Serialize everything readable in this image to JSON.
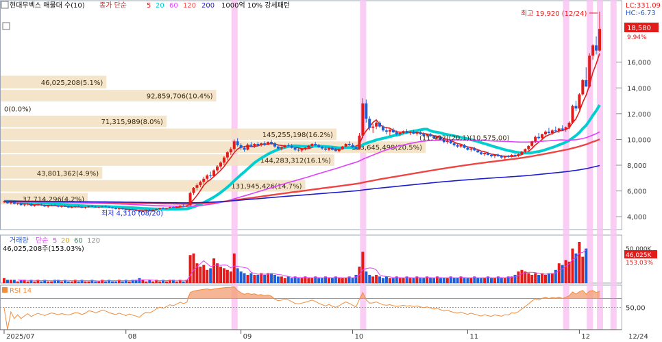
{
  "header": {
    "title": "현대무벡스 매물대 수(10)",
    "ma_label": "종가 단순",
    "ma_periods": [
      "5",
      "20",
      "60",
      "120",
      "200"
    ],
    "ma_colors": [
      "#e31a1c",
      "#00ced1",
      "#e040fb",
      "#ef4444",
      "#1d1dcc"
    ],
    "strong_label": "1000억 10% 강세패턴"
  },
  "right_info": {
    "lc": "LC:331.09",
    "hc": "HC:-6.73"
  },
  "price_badge": {
    "value": "18,580",
    "pct": "9.94%"
  },
  "annotations": {
    "high": "최고 19,920 (12/24)",
    "low": "최저 4,310 (08/20)"
  },
  "volume_panel": {
    "title": "거래량",
    "ma_label": "단순",
    "ma_periods": [
      "5",
      "20",
      "60",
      "120"
    ],
    "ma_colors": [
      "#e040fb",
      "#d4a017",
      "#2e8b57",
      "#888888"
    ],
    "info": "46,025,208주(153.03%)",
    "badge_value": "46,025K",
    "badge_pct": "153.03%",
    "axis_label": "50,000K"
  },
  "rsi_panel": {
    "title": "RSI 14",
    "axis_label": "50,00"
  },
  "date_labels": [
    "2025/07",
    "08",
    "09",
    "10",
    "11",
    "12",
    "12/24"
  ],
  "chart_data": {
    "type": "candlestick",
    "y_ticks": [
      "4,000",
      "6,000",
      "8,000",
      "10,000",
      "12,000",
      "14,000",
      "16,000"
    ],
    "ylim": [
      3000,
      19920
    ],
    "volume_profile": [
      {
        "label": "46,025,208(5.1%)",
        "price_low": 13900,
        "price_high": 15000,
        "width_pct": 5.1
      },
      {
        "label": "92,859,706(10.4%)",
        "price_low": 12900,
        "price_high": 13900,
        "width_pct": 10.4
      },
      {
        "label": "0(0.0%)",
        "price_low": 11900,
        "price_high": 12900,
        "width_pct": 0.0
      },
      {
        "label": "71,315,989(8.0%)",
        "price_low": 10900,
        "price_high": 11900,
        "width_pct": 8.0
      },
      {
        "label": "145,255,198(16.2%)",
        "price_low": 9900,
        "price_high": 10900,
        "width_pct": 16.2
      },
      {
        "label": "183,645,498(20.5%)",
        "price_low": 8900,
        "price_high": 9900,
        "width_pct": 20.5
      },
      {
        "label": "144,283,312(16.1%)",
        "price_low": 7900,
        "price_high": 8900,
        "width_pct": 16.1
      },
      {
        "label": "43,801,362(4.9%)",
        "price_low": 6900,
        "price_high": 7900,
        "width_pct": 4.9
      },
      {
        "label": "131,945,426(14.7%)",
        "price_low": 5900,
        "price_high": 6900,
        "width_pct": 14.7
      },
      {
        "label": "37,714,296(4.2%)",
        "price_low": 4900,
        "price_high": 5900,
        "width_pct": 4.2
      }
    ],
    "price_line_label": "(11,492)(20,1)(10,575,00)",
    "highlight_dates_index": [
      68,
      106,
      166,
      173,
      176,
      180
    ],
    "candles": [
      [
        5150,
        5250,
        5050,
        5200
      ],
      [
        5200,
        5280,
        5000,
        5050
      ],
      [
        5050,
        5200,
        4950,
        5150
      ],
      [
        5150,
        5180,
        4950,
        5000
      ],
      [
        5000,
        5100,
        4900,
        5050
      ],
      [
        5050,
        5100,
        4850,
        4900
      ],
      [
        4900,
        5000,
        4800,
        4950
      ],
      [
        4950,
        5050,
        4880,
        5000
      ],
      [
        5000,
        5050,
        4800,
        4850
      ],
      [
        4850,
        4950,
        4780,
        4900
      ],
      [
        4900,
        5000,
        4820,
        4950
      ],
      [
        4950,
        5020,
        4850,
        4880
      ],
      [
        4880,
        4950,
        4750,
        4800
      ],
      [
        4800,
        4900,
        4700,
        4850
      ],
      [
        4850,
        4950,
        4800,
        4900
      ],
      [
        4900,
        4980,
        4820,
        4850
      ],
      [
        4850,
        4900,
        4720,
        4780
      ],
      [
        4780,
        4880,
        4700,
        4820
      ],
      [
        4820,
        4900,
        4750,
        4770
      ],
      [
        4770,
        4850,
        4680,
        4720
      ],
      [
        4720,
        4800,
        4650,
        4760
      ],
      [
        4760,
        4850,
        4700,
        4800
      ],
      [
        4800,
        4880,
        4750,
        4780
      ],
      [
        4780,
        4820,
        4650,
        4700
      ],
      [
        4700,
        4780,
        4620,
        4740
      ],
      [
        4740,
        4850,
        4700,
        4820
      ],
      [
        4820,
        4900,
        4760,
        4790
      ],
      [
        4790,
        4850,
        4700,
        4720
      ],
      [
        4720,
        4800,
        4660,
        4760
      ],
      [
        4760,
        4840,
        4720,
        4800
      ],
      [
        4800,
        4880,
        4740,
        4770
      ],
      [
        4770,
        4820,
        4680,
        4700
      ],
      [
        4700,
        4760,
        4620,
        4650
      ],
      [
        4650,
        4720,
        4560,
        4600
      ],
      [
        4600,
        4680,
        4520,
        4640
      ],
      [
        4640,
        4700,
        4560,
        4580
      ],
      [
        4580,
        4640,
        4480,
        4520
      ],
      [
        4520,
        4600,
        4450,
        4560
      ],
      [
        4560,
        4620,
        4480,
        4500
      ],
      [
        4500,
        4560,
        4400,
        4450
      ],
      [
        4450,
        4520,
        4310,
        4380
      ],
      [
        4380,
        4500,
        4340,
        4460
      ],
      [
        4460,
        4560,
        4420,
        4520
      ],
      [
        4520,
        4600,
        4450,
        4480
      ],
      [
        4480,
        4550,
        4420,
        4530
      ],
      [
        4530,
        4620,
        4500,
        4600
      ],
      [
        4600,
        4700,
        4550,
        4660
      ],
      [
        4660,
        4750,
        4600,
        4620
      ],
      [
        4620,
        4700,
        4580,
        4680
      ],
      [
        4680,
        4780,
        4640,
        4750
      ],
      [
        4750,
        4850,
        4700,
        4720
      ],
      [
        4720,
        4800,
        4680,
        4780
      ],
      [
        4780,
        4900,
        4740,
        4860
      ],
      [
        4860,
        4950,
        4800,
        4820
      ],
      [
        4820,
        4900,
        4760,
        4880
      ],
      [
        4880,
        5950,
        4860,
        5850
      ],
      [
        5850,
        6300,
        5700,
        6250
      ],
      [
        6250,
        6600,
        6050,
        6450
      ],
      [
        6450,
        6800,
        6300,
        6700
      ],
      [
        6700,
        7100,
        6550,
        6950
      ],
      [
        6950,
        7300,
        6800,
        7200
      ],
      [
        7200,
        7500,
        7000,
        7150
      ],
      [
        7150,
        7700,
        7100,
        7600
      ],
      [
        7600,
        8000,
        7450,
        7900
      ],
      [
        7900,
        8300,
        7700,
        8200
      ],
      [
        8200,
        8700,
        8000,
        8600
      ],
      [
        8600,
        9100,
        8400,
        9000
      ],
      [
        9000,
        9400,
        8800,
        9250
      ],
      [
        9250,
        10000,
        9100,
        9850
      ],
      [
        9850,
        10100,
        9450,
        9550
      ],
      [
        9550,
        9700,
        9200,
        9350
      ],
      [
        9350,
        9500,
        9050,
        9200
      ],
      [
        9200,
        9700,
        9150,
        9600
      ],
      [
        9600,
        9800,
        9400,
        9500
      ],
      [
        9500,
        9700,
        9350,
        9650
      ],
      [
        9650,
        9800,
        9450,
        9550
      ],
      [
        9550,
        9750,
        9450,
        9700
      ],
      [
        9700,
        9850,
        9500,
        9600
      ],
      [
        9600,
        9850,
        9550,
        9800
      ],
      [
        9800,
        9950,
        9600,
        9700
      ],
      [
        9700,
        9800,
        9350,
        9450
      ],
      [
        9450,
        9550,
        9200,
        9300
      ],
      [
        9300,
        9450,
        9150,
        9400
      ],
      [
        9400,
        9600,
        9300,
        9550
      ],
      [
        9550,
        9700,
        9400,
        9500
      ],
      [
        9500,
        9650,
        9300,
        9350
      ],
      [
        9350,
        9450,
        9100,
        9200
      ],
      [
        9200,
        9350,
        9050,
        9150
      ],
      [
        9150,
        9300,
        9000,
        9250
      ],
      [
        9250,
        9400,
        9150,
        9350
      ],
      [
        9350,
        9550,
        9300,
        9500
      ],
      [
        9500,
        9700,
        9450,
        9650
      ],
      [
        9650,
        9800,
        9500,
        9550
      ],
      [
        9550,
        9650,
        9350,
        9400
      ],
      [
        9400,
        9500,
        9200,
        9300
      ],
      [
        9300,
        9450,
        9100,
        9200
      ],
      [
        9200,
        9400,
        9100,
        9350
      ],
      [
        9350,
        9450,
        9150,
        9200
      ],
      [
        9200,
        9350,
        9050,
        9100
      ],
      [
        9100,
        9300,
        9000,
        9250
      ],
      [
        9250,
        9500,
        9200,
        9450
      ],
      [
        9450,
        9700,
        9400,
        9650
      ],
      [
        9650,
        9850,
        9500,
        9550
      ],
      [
        9550,
        9700,
        9350,
        9400
      ],
      [
        9400,
        9550,
        9150,
        9250
      ],
      [
        9250,
        10500,
        9200,
        10300
      ],
      [
        10300,
        13200,
        10100,
        12800
      ],
      [
        12800,
        13100,
        11300,
        11600
      ],
      [
        11600,
        11800,
        10700,
        10900
      ],
      [
        10900,
        11200,
        10500,
        11000
      ],
      [
        11000,
        11400,
        10800,
        11300
      ],
      [
        11300,
        11400,
        10900,
        11000
      ],
      [
        11000,
        11100,
        10600,
        10700
      ],
      [
        10700,
        10900,
        10400,
        10600
      ],
      [
        10600,
        10800,
        10300,
        10750
      ],
      [
        10750,
        10900,
        10500,
        10550
      ],
      [
        10550,
        10700,
        10300,
        10400
      ],
      [
        10400,
        10600,
        10250,
        10500
      ],
      [
        10500,
        10700,
        10400,
        10650
      ],
      [
        10650,
        10800,
        10450,
        10500
      ],
      [
        10500,
        10650,
        10350,
        10600
      ],
      [
        10600,
        10750,
        10400,
        10450
      ],
      [
        10450,
        10600,
        10300,
        10550
      ],
      [
        10550,
        10650,
        10350,
        10400
      ],
      [
        10400,
        10550,
        10200,
        10300
      ],
      [
        10300,
        10450,
        10150,
        10400
      ],
      [
        10400,
        10500,
        10200,
        10250
      ],
      [
        10250,
        10350,
        10050,
        10100
      ],
      [
        10100,
        10250,
        9950,
        10200
      ],
      [
        10200,
        10300,
        9950,
        10000
      ],
      [
        10000,
        10100,
        9700,
        9800
      ],
      [
        9800,
        9950,
        9650,
        9900
      ],
      [
        9900,
        10000,
        9650,
        9700
      ],
      [
        9700,
        9800,
        9450,
        9550
      ],
      [
        9550,
        9650,
        9350,
        9450
      ],
      [
        9450,
        9600,
        9350,
        9550
      ],
      [
        9550,
        9650,
        9300,
        9350
      ],
      [
        9350,
        9450,
        9150,
        9200
      ],
      [
        9200,
        9350,
        9050,
        9300
      ],
      [
        9300,
        9400,
        9100,
        9150
      ],
      [
        9150,
        9250,
        8950,
        9000
      ],
      [
        9000,
        9100,
        8800,
        8850
      ],
      [
        8850,
        9000,
        8700,
        8950
      ],
      [
        8950,
        9050,
        8750,
        8800
      ],
      [
        8800,
        8900,
        8600,
        8700
      ],
      [
        8700,
        8850,
        8550,
        8800
      ],
      [
        8800,
        8900,
        8650,
        8700
      ],
      [
        8700,
        8800,
        8500,
        8600
      ],
      [
        8600,
        8750,
        8450,
        8700
      ],
      [
        8700,
        8800,
        8550,
        8650
      ],
      [
        8650,
        8850,
        8600,
        8800
      ],
      [
        8800,
        8950,
        8700,
        8750
      ],
      [
        8750,
        8900,
        8650,
        8850
      ],
      [
        8850,
        9100,
        8800,
        9050
      ],
      [
        9050,
        9300,
        8950,
        9250
      ],
      [
        9250,
        9550,
        9150,
        9500
      ],
      [
        9500,
        9900,
        9400,
        9850
      ],
      [
        9850,
        10300,
        9700,
        10200
      ],
      [
        10200,
        10500,
        10000,
        10100
      ],
      [
        10100,
        10450,
        9950,
        10400
      ],
      [
        10400,
        10700,
        10300,
        10600
      ],
      [
        10600,
        10900,
        10450,
        10500
      ],
      [
        10500,
        10800,
        10350,
        10700
      ],
      [
        10700,
        11000,
        10550,
        10650
      ],
      [
        10650,
        10900,
        10500,
        10850
      ],
      [
        10850,
        11100,
        10700,
        10750
      ],
      [
        10750,
        11000,
        10600,
        10950
      ],
      [
        10950,
        11400,
        10800,
        11300
      ],
      [
        11300,
        12700,
        11200,
        12600
      ],
      [
        12600,
        13000,
        12200,
        12400
      ],
      [
        12400,
        13600,
        12300,
        13500
      ],
      [
        13500,
        14700,
        13400,
        14600
      ],
      [
        14600,
        15600,
        14300,
        14100
      ],
      [
        14100,
        16700,
        14000,
        16500
      ],
      [
        16500,
        17400,
        16200,
        17300
      ],
      [
        17300,
        18000,
        16600,
        16900
      ],
      [
        16900,
        19920,
        16800,
        18580
      ]
    ],
    "volumes": [
      3,
      2,
      2,
      2,
      1,
      2,
      2,
      1,
      2,
      1,
      2,
      1,
      2,
      1,
      1,
      2,
      2,
      1,
      2,
      1,
      1,
      2,
      1,
      2,
      1,
      1,
      2,
      1,
      1,
      2,
      1,
      2,
      1,
      1,
      2,
      1,
      2,
      1,
      2,
      2,
      3,
      2,
      1,
      2,
      1,
      2,
      1,
      2,
      1,
      2,
      2,
      1,
      2,
      1,
      2,
      17,
      18,
      12,
      10,
      11,
      8,
      9,
      15,
      12,
      10,
      9,
      8,
      7,
      18,
      9,
      7,
      6,
      5,
      6,
      5,
      5,
      6,
      5,
      6,
      6,
      5,
      4,
      4,
      3,
      4,
      3,
      4,
      3,
      3,
      4,
      3,
      3,
      4,
      3,
      3,
      4,
      3,
      3,
      4,
      3,
      3,
      3,
      4,
      3,
      5,
      10,
      19,
      7,
      5,
      4,
      5,
      4,
      3,
      4,
      3,
      3,
      4,
      3,
      3,
      4,
      3,
      3,
      4,
      3,
      3,
      4,
      3,
      3,
      4,
      3,
      3,
      3,
      4,
      3,
      3,
      4,
      3,
      3,
      3,
      4,
      3,
      3,
      3,
      4,
      3,
      3,
      4,
      3,
      3,
      4,
      4,
      5,
      7,
      8,
      7,
      6,
      5,
      6,
      5,
      6,
      5,
      6,
      6,
      8,
      12,
      11,
      14,
      13,
      21,
      18,
      25,
      16,
      21
    ],
    "volume_colors_hint": "red=up, blue=down"
  }
}
